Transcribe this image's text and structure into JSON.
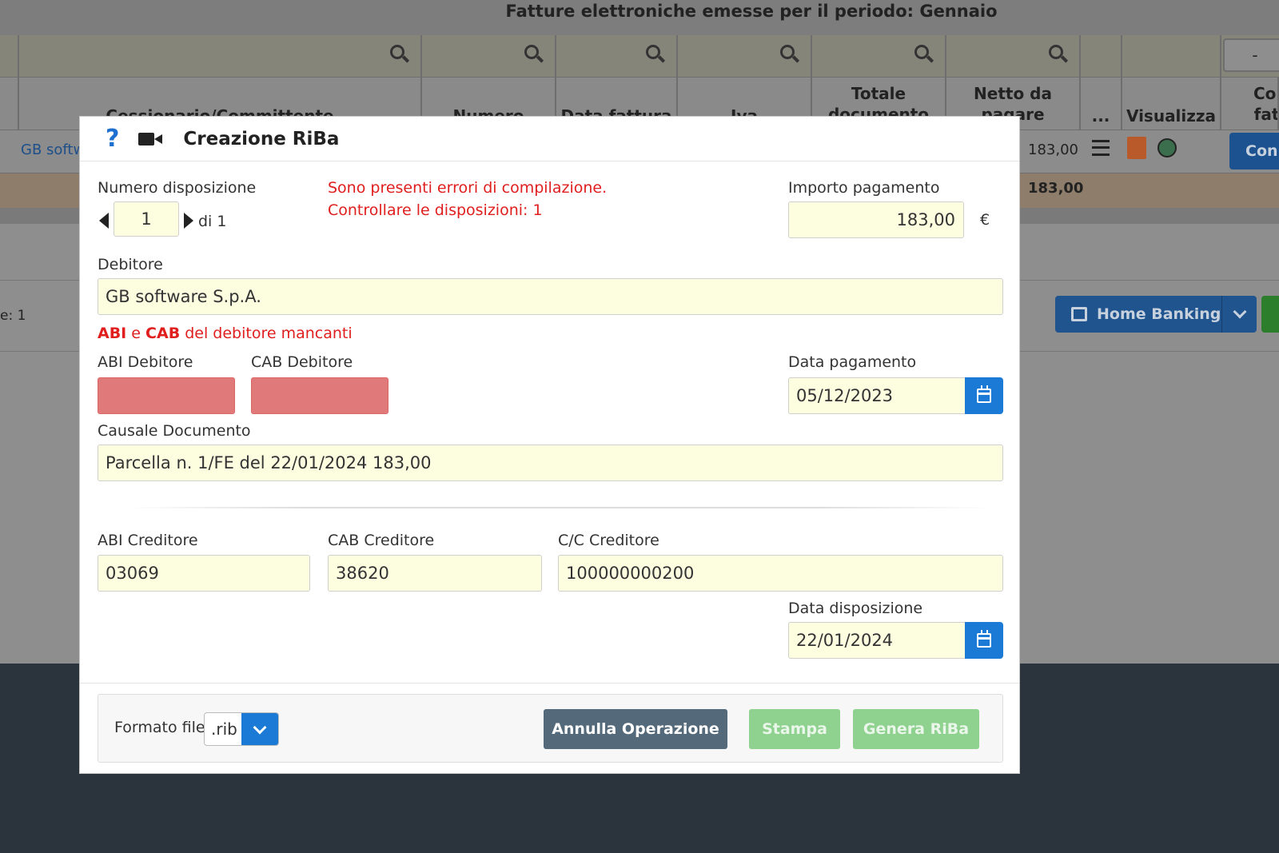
{
  "background": {
    "page_title": "Fatture elettroniche emesse per il periodo: Gennaio",
    "columns": [
      "Cessionario/Committente",
      "Numero",
      "Data fattura",
      "Iva",
      "Totale documento",
      "Netto da pagare",
      "...",
      "Visualizza",
      "Con fatt"
    ],
    "row": {
      "cliente": "GB softw",
      "netto": "183,00",
      "cont_label": "Con"
    },
    "totals": {
      "netto": "183,00"
    },
    "left_info": "e: 1",
    "minus_label": "-",
    "home_banking_label": "Home Banking"
  },
  "modal": {
    "title": "Creazione RiBa",
    "numero_disposizione_label": "Numero disposizione",
    "numero_disposizione_value": "1",
    "di_label": "di 1",
    "error_line1": "Sono presenti errori di compilazione.",
    "error_line2": "Controllare le disposizioni: 1",
    "importo_label": "Importo pagamento",
    "importo_value": "183,00",
    "currency": "€",
    "debitore_label": "Debitore",
    "debitore_value": "GB software S.p.A.",
    "abi_cab_error": {
      "abi": "ABI",
      "e": " e ",
      "cab": "CAB",
      "rest": " del debitore mancanti"
    },
    "abi_debitore_label": "ABI Debitore",
    "abi_debitore_value": "",
    "cab_debitore_label": "CAB Debitore",
    "cab_debitore_value": "",
    "data_pagamento_label": "Data pagamento",
    "data_pagamento_value": "05/12/2023",
    "causale_label": "Causale Documento",
    "causale_value": "Parcella n. 1/FE del 22/01/2024 183,00",
    "abi_creditore_label": "ABI Creditore",
    "abi_creditore_value": "03069",
    "cab_creditore_label": "CAB Creditore",
    "cab_creditore_value": "38620",
    "cc_creditore_label": "C/C Creditore",
    "cc_creditore_value": "100000000200",
    "data_disposizione_label": "Data disposizione",
    "data_disposizione_value": "22/01/2024",
    "formato_label": "Formato file:",
    "formato_value": ".rib",
    "annulla_label": "Annulla Operazione",
    "stampa_label": "Stampa",
    "genera_label": "Genera RiBa"
  },
  "colors": {
    "accent": "#1b7ad6",
    "error": "#e01e1e",
    "input_bg": "#fdfde0",
    "error_input": "#e07a7a",
    "success_btn": "#8fd18f",
    "annulla_btn": "#546a7b"
  }
}
